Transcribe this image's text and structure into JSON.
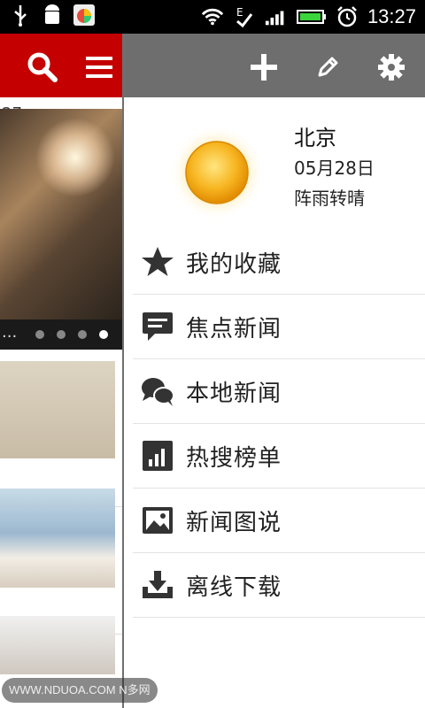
{
  "status_bar": {
    "time": "13:27",
    "icons": [
      "usb-icon",
      "android-debug-icon",
      "app-icon",
      "wifi-icon",
      "signal-icon",
      "battery-icon",
      "alarm-icon"
    ]
  },
  "left_panel": {
    "header_color": "#c40000",
    "date_fragment": "27",
    "hero_caption": "...",
    "pager_total": 4,
    "pager_active": 4
  },
  "drawer": {
    "header_color": "#6e6e6e",
    "weather": {
      "city": "北京",
      "date": "05月28日",
      "condition": "阵雨转晴"
    },
    "menu": [
      {
        "label": "我的收藏",
        "icon": "star-icon"
      },
      {
        "label": "焦点新闻",
        "icon": "speech-bubble-icon"
      },
      {
        "label": "本地新闻",
        "icon": "chat-bubbles-icon"
      },
      {
        "label": "热搜榜单",
        "icon": "bar-chart-icon"
      },
      {
        "label": "新闻图说",
        "icon": "image-icon"
      },
      {
        "label": "离线下载",
        "icon": "download-tray-icon"
      }
    ]
  },
  "watermark": "WWW.NDUOA.COM N多网"
}
